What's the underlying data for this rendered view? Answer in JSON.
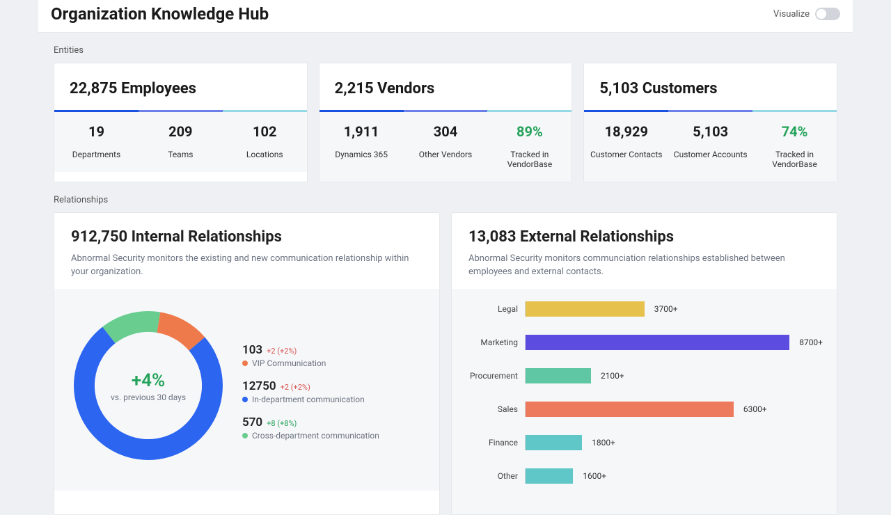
{
  "header": {
    "title": "Organization Knowledge Hub",
    "visualize_label": "Visualize"
  },
  "entities": {
    "section_label": "Entities",
    "cards": [
      {
        "title": "22,875 Employees",
        "cols": [
          {
            "value": "19",
            "label": "Departments",
            "accent": "#1951e0",
            "green": false
          },
          {
            "value": "209",
            "label": "Teams",
            "accent": "#6b7fe8",
            "green": false
          },
          {
            "value": "102",
            "label": "Locations",
            "accent": "#96d9e6",
            "green": false
          }
        ]
      },
      {
        "title": "2,215 Vendors",
        "cols": [
          {
            "value": "1,911",
            "label": "Dynamics 365",
            "accent": "#1951e0",
            "green": false
          },
          {
            "value": "304",
            "label": "Other Vendors",
            "accent": "#6b7fe8",
            "green": false
          },
          {
            "value": "89%",
            "label": "Tracked in VendorBase",
            "accent": "#96d9e6",
            "green": true
          }
        ]
      },
      {
        "title": "5,103 Customers",
        "cols": [
          {
            "value": "18,929",
            "label": "Customer Contacts",
            "accent": "#1951e0",
            "green": false
          },
          {
            "value": "5,103",
            "label": "Customer Accounts",
            "accent": "#6b7fe8",
            "green": false
          },
          {
            "value": "74%",
            "label": "Tracked in VendorBase",
            "accent": "#96d9e6",
            "green": true
          }
        ]
      }
    ]
  },
  "relationships": {
    "section_label": "Relationships",
    "internal": {
      "title": "912,750 Internal Relationships",
      "desc": "Abnormal Security monitors the existing and new communication relationship within your organization.",
      "donut": {
        "center_value": "+4%",
        "center_sub": "vs. previous 30 days",
        "legend": [
          {
            "value": "103",
            "delta": "+2 (+2%)",
            "delta_green": false,
            "label": "VIP Communication",
            "color": "#ee7a4c"
          },
          {
            "value": "12750",
            "delta": "+2 (+2%)",
            "delta_green": false,
            "label": "In-department communication",
            "color": "#2b65f0"
          },
          {
            "value": "570",
            "delta": "+8 (+8%)",
            "delta_green": true,
            "label": "Cross-department communication",
            "color": "#69cd8f"
          }
        ]
      }
    },
    "external": {
      "title": "13,083 External Relationships",
      "desc": "Abnormal Security monitors communciation relationships established between employees and external contacts.",
      "bars": [
        {
          "category": "Legal",
          "value_label": "3700+",
          "width_pct": 40,
          "color": "#e6c24d"
        },
        {
          "category": "Marketing",
          "value_label": "8700+",
          "width_pct": 95,
          "color": "#5c4de0"
        },
        {
          "category": "Procurement",
          "value_label": "2100+",
          "width_pct": 22,
          "color": "#5fc7a3"
        },
        {
          "category": "Sales",
          "value_label": "6300+",
          "width_pct": 70,
          "color": "#ee7a5e"
        },
        {
          "category": "Finance",
          "value_label": "1800+",
          "width_pct": 19,
          "color": "#5fc7c7"
        },
        {
          "category": "Other",
          "value_label": "1600+",
          "width_pct": 16,
          "color": "#5fc7c7"
        }
      ]
    }
  },
  "chart_data": [
    {
      "type": "pie",
      "title": "Internal Relationships breakdown",
      "series": [
        {
          "name": "VIP Communication",
          "value": 103,
          "delta": 2,
          "delta_pct": 2
        },
        {
          "name": "In-department communication",
          "value": 12750,
          "delta": 2,
          "delta_pct": 2
        },
        {
          "name": "Cross-department communication",
          "value": 570,
          "delta": 8,
          "delta_pct": 8
        }
      ],
      "center_annotation": "+4% vs. previous 30 days"
    },
    {
      "type": "bar",
      "orientation": "horizontal",
      "title": "External Relationships by department",
      "categories": [
        "Legal",
        "Marketing",
        "Procurement",
        "Sales",
        "Finance",
        "Other"
      ],
      "values": [
        3700,
        8700,
        2100,
        6300,
        1800,
        1600
      ],
      "value_suffix": "+",
      "xlim": [
        0,
        9000
      ]
    }
  ]
}
